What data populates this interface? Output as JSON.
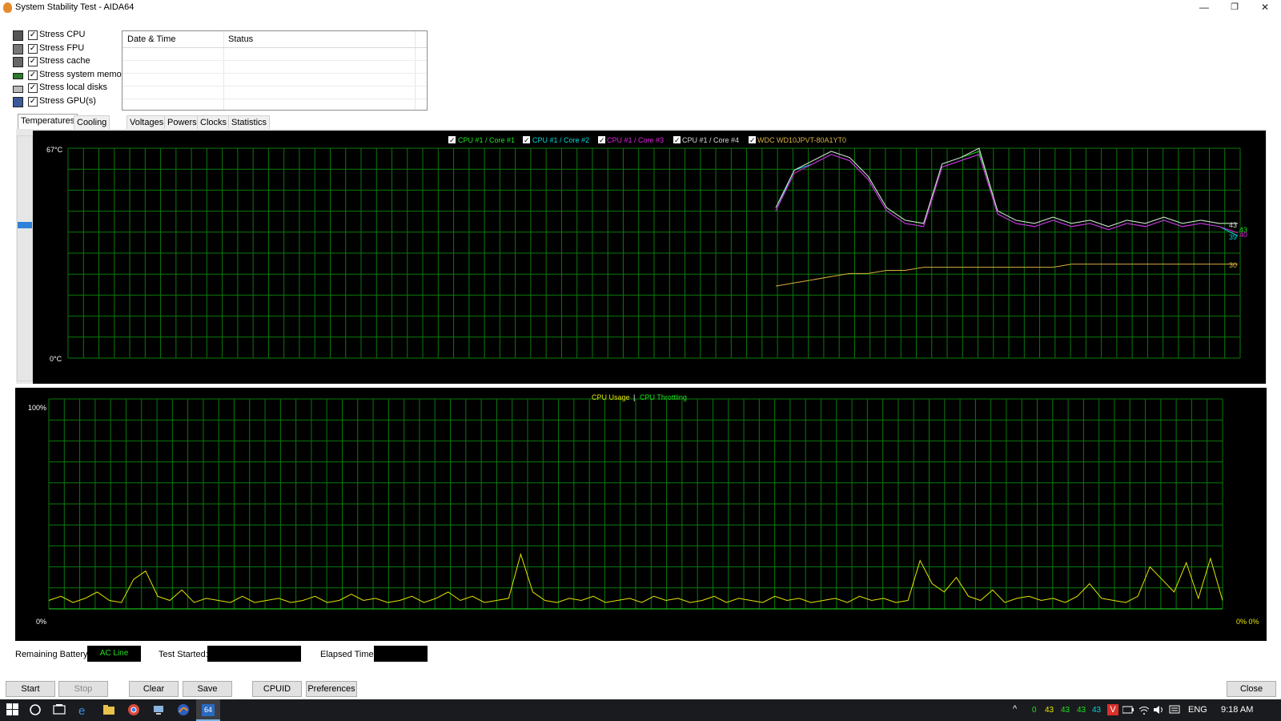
{
  "window": {
    "title": "System Stability Test - AIDA64",
    "min": "—",
    "restore": "❐",
    "close": "✕"
  },
  "stress_options": [
    {
      "label": "Stress CPU",
      "checked": true,
      "icon": "cpu-icon"
    },
    {
      "label": "Stress FPU",
      "checked": true,
      "icon": "fpu-icon"
    },
    {
      "label": "Stress cache",
      "checked": true,
      "icon": "cache-icon"
    },
    {
      "label": "Stress system memory",
      "checked": true,
      "icon": "memory-icon"
    },
    {
      "label": "Stress local disks",
      "checked": true,
      "icon": "disk-icon"
    },
    {
      "label": "Stress GPU(s)",
      "checked": true,
      "icon": "gpu-icon"
    }
  ],
  "log_table": {
    "columns": [
      "Date & Time",
      "Status"
    ]
  },
  "tabs": [
    "Temperatures",
    "Cooling Fans",
    "Voltages",
    "Powers",
    "Clocks",
    "Statistics"
  ],
  "temp_graph": {
    "y_max_label": "67°C",
    "y_min_label": "0°C",
    "legend": [
      {
        "label": "CPU #1 / Core #1",
        "color": "#1ee61e"
      },
      {
        "label": "CPU #1 / Core #2",
        "color": "#00d7d7"
      },
      {
        "label": "CPU #1 / Core #3",
        "color": "#e020e0"
      },
      {
        "label": "CPU #1 / Core #4",
        "color": "#d8d8d8"
      },
      {
        "label": "WDC WD10JPVT-80A1YT0",
        "color": "#d8b040"
      }
    ],
    "end_labels": [
      "43",
      "43",
      "40",
      "39",
      "30"
    ]
  },
  "usage_graph": {
    "legend_usage": "CPU Usage",
    "legend_sep": "|",
    "legend_throttle": "CPU Throttling",
    "y_max_label": "100%",
    "y_min_label": "0%",
    "end_label": "0% 0%"
  },
  "colors": {
    "grid": "#0a7a0a",
    "usage": "#e6e600",
    "throttle": "#1ee61e",
    "accent": "#2f80d8"
  },
  "chart_data": [
    {
      "type": "line",
      "title": "Temperatures",
      "xlabel": "",
      "ylabel": "",
      "ylim": [
        0,
        67
      ],
      "series": [
        {
          "name": "CPU #1 / Core #1",
          "values": [
            48,
            60,
            63,
            66,
            64,
            58,
            48,
            44,
            43,
            62,
            64,
            66,
            47,
            44,
            43,
            45,
            43,
            44,
            42,
            44,
            43,
            45,
            43,
            44,
            43,
            43
          ]
        },
        {
          "name": "CPU #1 / Core #2",
          "values": [
            47,
            60,
            62,
            65,
            63,
            57,
            47,
            43,
            42,
            61,
            63,
            65,
            46,
            43,
            42,
            44,
            42,
            43,
            41,
            43,
            42,
            44,
            42,
            43,
            42,
            39
          ]
        },
        {
          "name": "CPU #1 / Core #3",
          "values": [
            47,
            59,
            62,
            65,
            63,
            57,
            47,
            43,
            42,
            61,
            63,
            65,
            46,
            43,
            42,
            44,
            42,
            43,
            41,
            43,
            42,
            44,
            42,
            43,
            42,
            40
          ]
        },
        {
          "name": "CPU #1 / Core #4",
          "values": [
            48,
            60,
            63,
            66,
            64,
            58,
            48,
            44,
            43,
            62,
            64,
            67,
            47,
            44,
            43,
            45,
            43,
            44,
            42,
            44,
            43,
            45,
            43,
            44,
            43,
            43
          ]
        },
        {
          "name": "WDC WD10JPVT-80A1YT0",
          "values": [
            23,
            24,
            25,
            26,
            27,
            27,
            28,
            28,
            29,
            29,
            29,
            29,
            29,
            29,
            29,
            29,
            30,
            30,
            30,
            30,
            30,
            30,
            30,
            30,
            30,
            30
          ]
        }
      ],
      "legend": "top-center",
      "grid": true
    },
    {
      "type": "line",
      "title": "",
      "xlabel": "",
      "ylabel": "",
      "ylim": [
        0,
        100
      ],
      "series": [
        {
          "name": "CPU Usage",
          "values": [
            4,
            6,
            3,
            5,
            8,
            4,
            3,
            14,
            18,
            6,
            4,
            9,
            3,
            5,
            4,
            3,
            6,
            3,
            4,
            5,
            3,
            4,
            6,
            3,
            4,
            7,
            4,
            5,
            3,
            4,
            6,
            3,
            5,
            8,
            4,
            6,
            3,
            4,
            5,
            26,
            8,
            4,
            3,
            5,
            4,
            6,
            3,
            4,
            5,
            3,
            6,
            4,
            5,
            3,
            4,
            6,
            3,
            5,
            4,
            3,
            6,
            4,
            5,
            3,
            4,
            5,
            3,
            6,
            4,
            5,
            3,
            4,
            23,
            12,
            8,
            15,
            6,
            4,
            9,
            3,
            5,
            6,
            4,
            5,
            3,
            6,
            12,
            5,
            4,
            3,
            6,
            20,
            14,
            8,
            22,
            5,
            24,
            4
          ]
        },
        {
          "name": "CPU Throttling",
          "values": [
            0,
            0,
            0,
            0,
            0,
            0,
            0,
            0,
            0,
            0,
            0,
            0,
            0,
            0,
            0,
            0,
            0,
            0,
            0,
            0,
            0,
            0,
            0,
            0,
            0,
            0,
            0,
            0,
            0,
            0,
            0,
            0,
            0,
            0,
            0,
            0,
            0,
            0,
            0,
            0,
            0,
            0,
            0,
            0,
            0,
            0,
            0,
            0,
            0,
            0,
            0,
            0,
            0,
            0,
            0,
            0,
            0,
            0,
            0,
            0,
            0,
            0,
            0,
            0,
            0,
            0,
            0,
            0,
            0,
            0,
            0,
            0,
            0,
            0,
            0,
            0,
            0,
            0,
            0,
            0,
            0,
            0,
            0,
            0,
            0,
            0,
            0,
            0,
            0,
            0,
            0,
            0,
            0,
            0,
            0,
            0,
            0,
            0
          ]
        }
      ],
      "legend": "top-center",
      "grid": true
    }
  ],
  "footer": {
    "battery_label": "Remaining Battery:",
    "battery_value": "AC Line",
    "started_label": "Test Started:",
    "started_value": "",
    "elapsed_label": "Elapsed Time:",
    "elapsed_value": ""
  },
  "buttons": {
    "start": "Start",
    "stop": "Stop",
    "clear": "Clear",
    "save": "Save",
    "cpuid": "CPUID",
    "preferences": "Preferences",
    "close": "Close"
  },
  "taskbar": {
    "temps": [
      "0",
      "43",
      "43",
      "43",
      "43"
    ],
    "lang": "ENG",
    "time": "9:18 AM"
  }
}
